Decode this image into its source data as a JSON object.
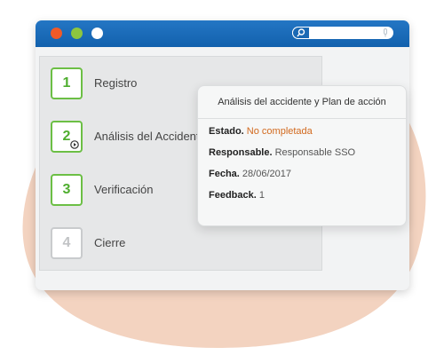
{
  "colors": {
    "blob": "#f3d3c0",
    "titlebar": "#1a69b4",
    "accent_green": "#6cbf45",
    "status_warning": "#d2691e"
  },
  "window": {
    "buttons": [
      "red-dot",
      "green-dot",
      "white-dot"
    ],
    "search": {
      "icon": "search-icon",
      "value": "",
      "mic_icon": "microphone-icon"
    }
  },
  "steps": [
    {
      "number": "1",
      "label": "Registro",
      "state": "done"
    },
    {
      "number": "2",
      "label": "Análisis del Accidente",
      "state": "current",
      "icon": "play-icon"
    },
    {
      "number": "3",
      "label": "Verificación",
      "state": "done"
    },
    {
      "number": "4",
      "label": "Cierre",
      "state": "pending"
    }
  ],
  "popup": {
    "title": "Análisis del accidente y Plan de acción",
    "fields": [
      {
        "key": "Estado.",
        "value": "No completada",
        "status": "warning"
      },
      {
        "key": "Responsable.",
        "value": "Responsable SSO"
      },
      {
        "key": "Fecha.",
        "value": "28/06/2017"
      },
      {
        "key": "Feedback.",
        "value": "1"
      }
    ]
  }
}
